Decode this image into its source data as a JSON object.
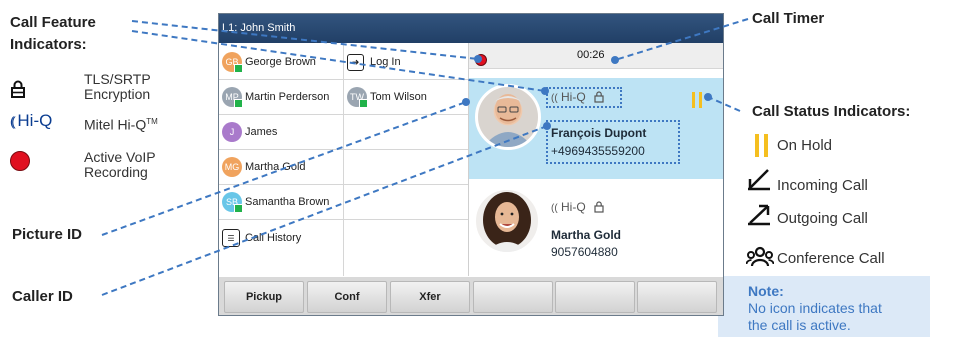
{
  "labels": {
    "call_feature_indicators": "Call Feature\nIndicators:",
    "picture_id": "Picture ID",
    "caller_id": "Caller ID",
    "call_timer": "Call Timer",
    "call_status_indicators": "Call Status Indicators:"
  },
  "feature_legend": {
    "tls_srtp": "TLS/SRTP\nEncryption",
    "hiq_glyph": "Hi-Q",
    "hiq_label": "Mitel Hi-Q",
    "hiq_tm": "TM",
    "recording": "Active VoIP\nRecording"
  },
  "status_legend": {
    "on_hold": "On Hold",
    "incoming": "Incoming Call",
    "outgoing": "Outgoing Call",
    "conference": "Conference Call"
  },
  "note": {
    "title": "Note:",
    "body": "No icon indicates that\nthe call is active."
  },
  "phone": {
    "title": "L1: John Smith",
    "timer": "00:26",
    "contacts_left": [
      {
        "initials": "GB",
        "name": "George Brown",
        "color": "#f0a35e"
      },
      {
        "initials": "MP",
        "name": "Martin Perderson",
        "color": "#9aa5b1"
      },
      {
        "initials": "J",
        "name": "James",
        "color": "#a97acb"
      },
      {
        "initials": "MG",
        "name": "Martha Gold",
        "color": "#f0a35e"
      },
      {
        "initials": "SB",
        "name": "Samantha Brown",
        "color": "#68c6e8"
      }
    ],
    "call_history": "Call History",
    "login": "Log In",
    "contact_right": {
      "initials": "TW",
      "name": "Tom Wilson",
      "color": "#9aa5b1"
    },
    "call1": {
      "name": "François Dupont",
      "number": "+4969435559200",
      "hiq": "Hi-Q"
    },
    "call2": {
      "name": "Martha Gold",
      "number": "9057604880",
      "hiq": "Hi-Q"
    },
    "softkeys": [
      "Pickup",
      "Conf",
      "Xfer",
      "",
      "",
      ""
    ]
  },
  "colors": {
    "accent_blue": "#3e78c2",
    "hold_yellow": "#f5bf1f",
    "record_red": "#e01020",
    "titlebar": "#2a4a72"
  }
}
